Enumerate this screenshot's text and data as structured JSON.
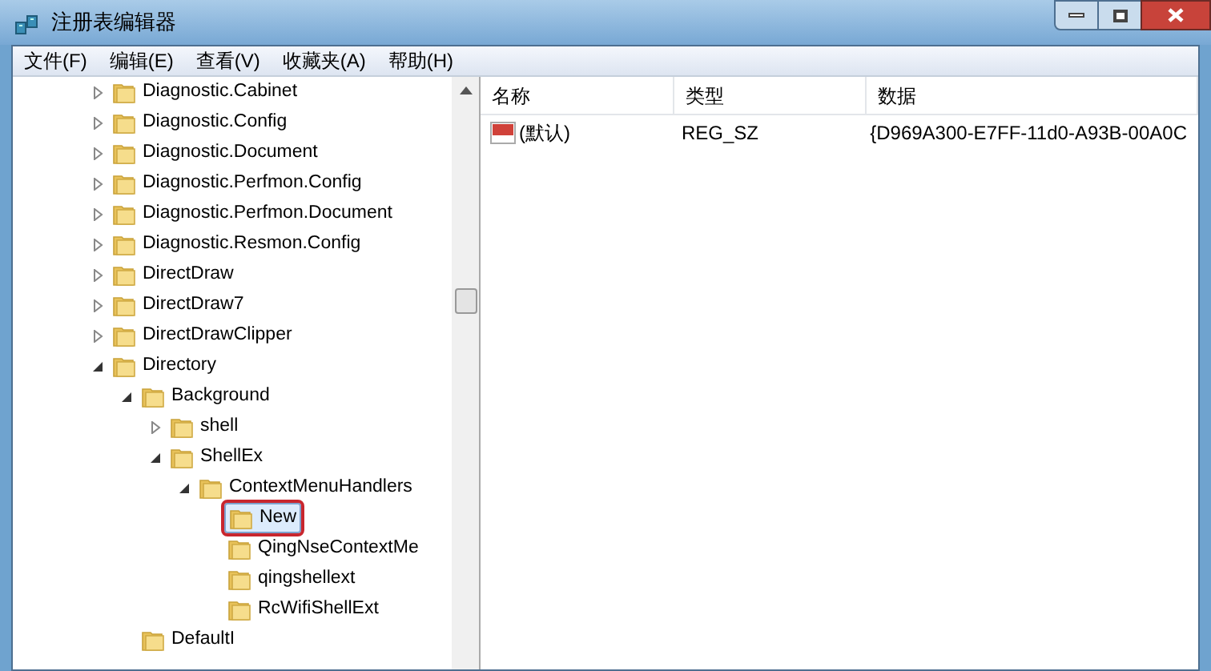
{
  "window": {
    "title": "注册表编辑器"
  },
  "menu": [
    "文件(F)",
    "编辑(E)",
    "查看(V)",
    "收藏夹(A)",
    "帮助(H)"
  ],
  "tree": [
    {
      "label": "Diagnostic.Cabinet",
      "expandable": true,
      "expanded": false,
      "selected": false
    },
    {
      "label": "Diagnostic.Config",
      "expandable": true,
      "expanded": false,
      "selected": false
    },
    {
      "label": "Diagnostic.Document",
      "expandable": true,
      "expanded": false,
      "selected": false
    },
    {
      "label": "Diagnostic.Perfmon.Config",
      "expandable": true,
      "expanded": false,
      "selected": false
    },
    {
      "label": "Diagnostic.Perfmon.Document",
      "expandable": true,
      "expanded": false,
      "selected": false
    },
    {
      "label": "Diagnostic.Resmon.Config",
      "expandable": true,
      "expanded": false,
      "selected": false
    },
    {
      "label": "DirectDraw",
      "expandable": true,
      "expanded": false,
      "selected": false
    },
    {
      "label": "DirectDraw7",
      "expandable": true,
      "expanded": false,
      "selected": false
    },
    {
      "label": "DirectDrawClipper",
      "expandable": true,
      "expanded": false,
      "selected": false
    },
    {
      "label": "Directory",
      "expandable": true,
      "expanded": true,
      "selected": false,
      "children": [
        {
          "label": "Background",
          "expandable": true,
          "expanded": true,
          "selected": false,
          "children": [
            {
              "label": "shell",
              "expandable": true,
              "expanded": false,
              "selected": false
            },
            {
              "label": "ShellEx",
              "expandable": true,
              "expanded": true,
              "selected": false,
              "children": [
                {
                  "label": "ContextMenuHandlers",
                  "expandable": true,
                  "expanded": true,
                  "selected": false,
                  "children": [
                    {
                      "label": "New",
                      "expandable": false,
                      "expanded": false,
                      "selected": true,
                      "highlighted": true
                    },
                    {
                      "label": "QingNseContextMe",
                      "expandable": false,
                      "expanded": false,
                      "selected": false,
                      "highlighted": false
                    },
                    {
                      "label": "qingshellext",
                      "expandable": false,
                      "expanded": false,
                      "selected": false,
                      "highlighted": false
                    },
                    {
                      "label": "RcWifiShellExt",
                      "expandable": false,
                      "expanded": false,
                      "selected": false,
                      "highlighted": false
                    }
                  ]
                }
              ]
            }
          ]
        },
        {
          "label": "DefaultI",
          "expandable": false,
          "expanded": false,
          "selected": false
        }
      ]
    }
  ],
  "table": {
    "columns": [
      "名称",
      "类型",
      "数据"
    ],
    "rows": [
      {
        "kind": "string",
        "name": "(默认)",
        "type": "REG_SZ",
        "data": "{D969A300-E7FF-11d0-A93B-00A0C"
      }
    ]
  }
}
